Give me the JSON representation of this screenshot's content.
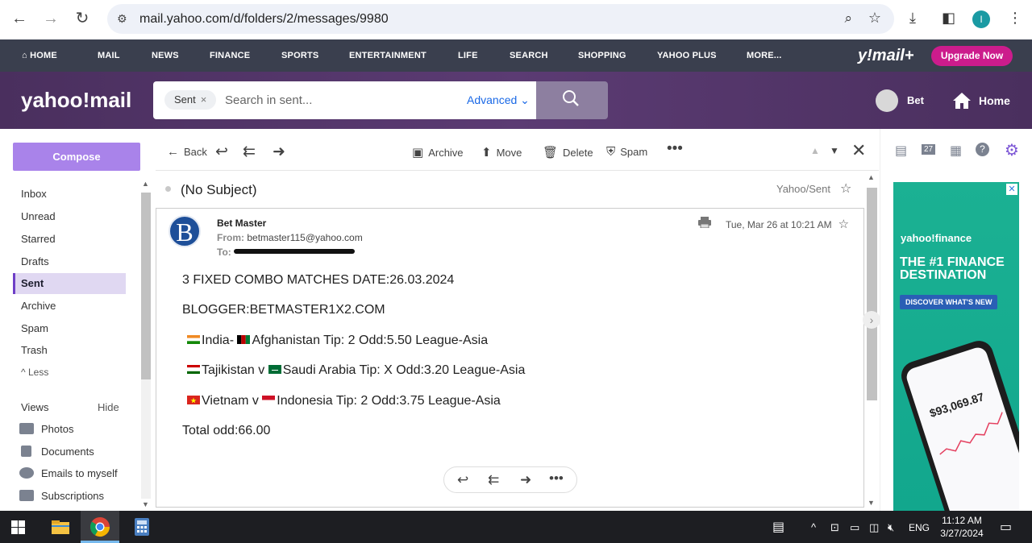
{
  "browser": {
    "url": "mail.yahoo.com/d/folders/2/messages/9980",
    "profile_initial": "I"
  },
  "topnav": {
    "items": [
      "HOME",
      "MAIL",
      "NEWS",
      "FINANCE",
      "SPORTS",
      "ENTERTAINMENT",
      "LIFE",
      "SEARCH",
      "SHOPPING",
      "YAHOO PLUS",
      "MORE..."
    ],
    "logo": "y!mail+",
    "upgrade": "Upgrade Now"
  },
  "header": {
    "logo": "yahoo!mail",
    "search_chip": "Sent",
    "search_placeholder": "Search in sent...",
    "advanced": "Advanced",
    "user": "Bet",
    "home": "Home"
  },
  "sidebar": {
    "compose": "Compose",
    "folders": [
      "Inbox",
      "Unread",
      "Starred",
      "Drafts",
      "Sent",
      "Archive",
      "Spam",
      "Trash"
    ],
    "active_folder": "Sent",
    "less": "Less",
    "views_label": "Views",
    "hide_label": "Hide",
    "views": [
      "Photos",
      "Documents",
      "Emails to myself",
      "Subscriptions"
    ]
  },
  "toolbar": {
    "back": "Back",
    "archive": "Archive",
    "move": "Move",
    "delete": "Delete",
    "spam": "Spam"
  },
  "message": {
    "subject": "(No Subject)",
    "folder": "Yahoo/Sent",
    "sender_initial": "B",
    "sender": "Bet Master",
    "from_label": "From:",
    "from": "betmaster115@yahoo.com",
    "to_label": "To:",
    "date": "Tue, Mar 26 at 10:21 AM",
    "body": {
      "line1": "3 FIXED COMBO MATCHES DATE:26.03.2024",
      "line2": "BLOGGER:BETMASTER1X2.COM",
      "m1_team1": "India- ",
      "m1_team2": "Afghanistan Tip: 2 Odd:5.50 League-Asia",
      "m2_team1": "Tajikistan v ",
      "m2_team2": "Saudi Arabia Tip: X Odd:3.20 League-Asia",
      "m3_team1": "Vietnam v ",
      "m3_team2": "Indonesia Tip: 2 Odd:3.75 League-Asia",
      "total": "Total odd:66.00"
    }
  },
  "ad": {
    "brand": "yahoo!finance",
    "headline": "THE #1 FINANCE DESTINATION",
    "cta": "DISCOVER WHAT'S NEW",
    "amount": "$93,069.87"
  },
  "taskbar": {
    "lang": "ENG",
    "time": "11:12 AM",
    "date": "3/27/2024"
  },
  "rail": {
    "calendar_day": "27"
  }
}
